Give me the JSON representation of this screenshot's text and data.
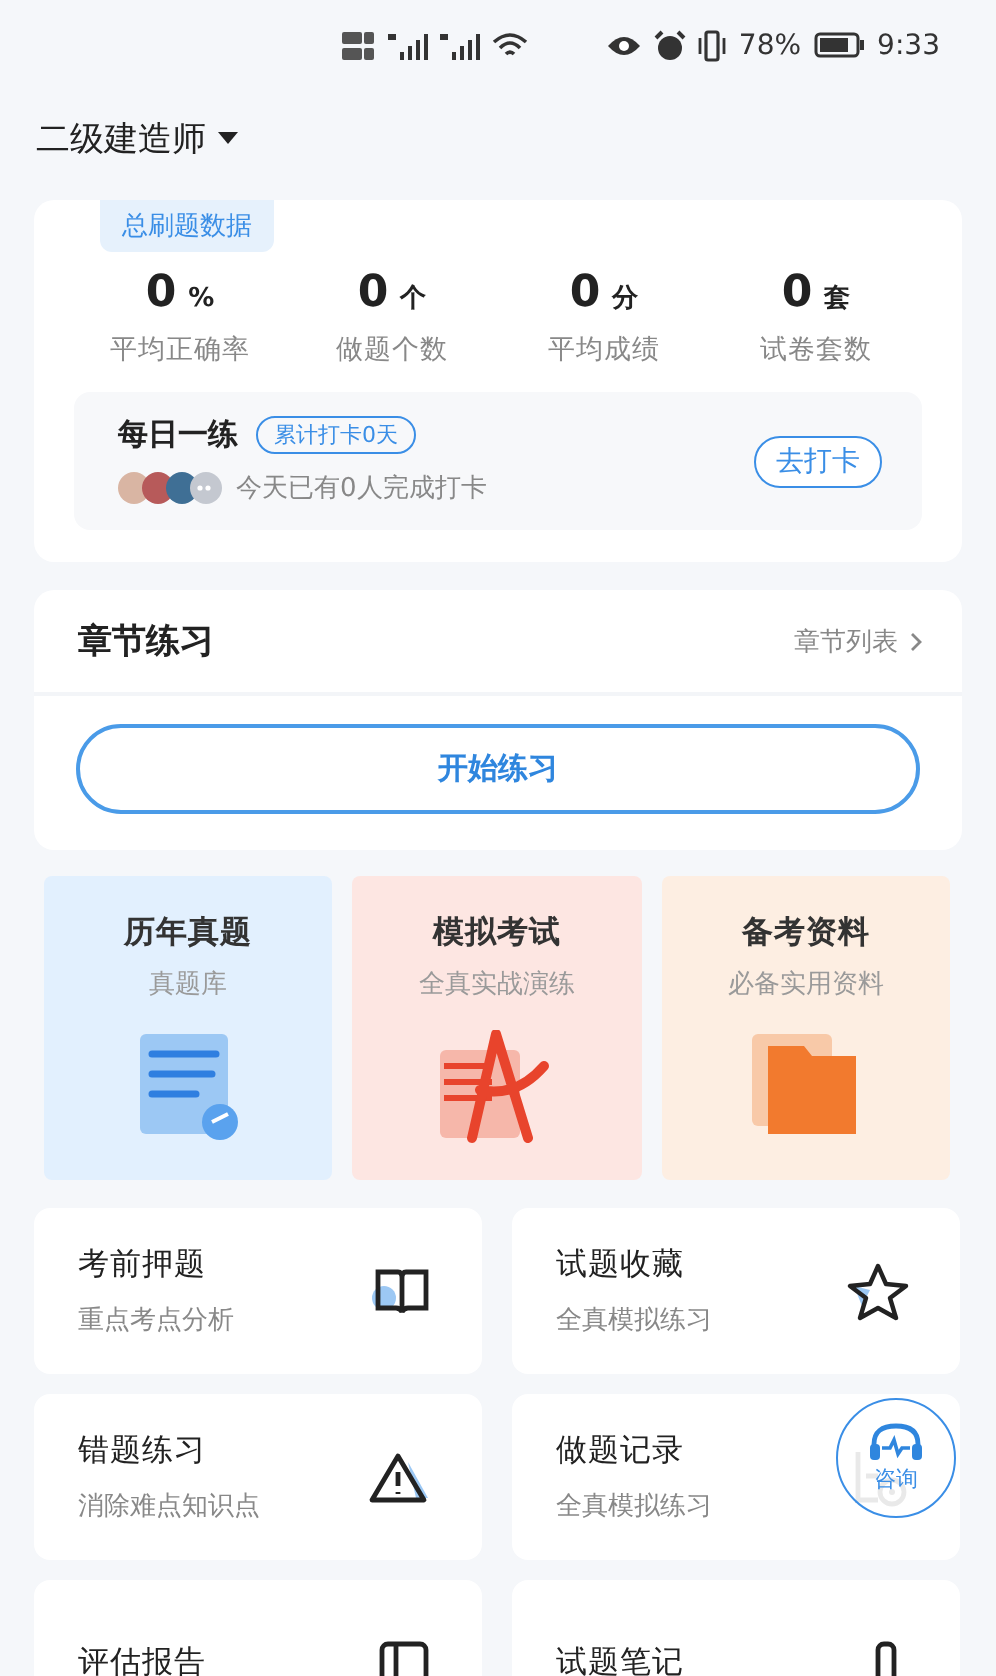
{
  "status_bar": {
    "battery": "78%",
    "time": "9:33"
  },
  "header": {
    "title": "二级建造师"
  },
  "stats_card": {
    "tab": "总刷题数据",
    "stats": [
      {
        "value": "0",
        "unit": "%",
        "label": "平均正确率"
      },
      {
        "value": "0",
        "unit": "个",
        "label": "做题个数"
      },
      {
        "value": "0",
        "unit": "分",
        "label": "平均成绩"
      },
      {
        "value": "0",
        "unit": "套",
        "label": "试卷套数"
      }
    ],
    "daily": {
      "title": "每日一练",
      "badge": "累计打卡0天",
      "note": "今天已有0人完成打卡",
      "button": "去打卡"
    }
  },
  "chapter": {
    "title": "章节练习",
    "link": "章节列表",
    "button": "开始练习"
  },
  "tiles": [
    {
      "kind": "papers",
      "title": "历年真题",
      "subtitle": "真题库",
      "color": "#e2f0fe"
    },
    {
      "kind": "compass",
      "title": "模拟考试",
      "subtitle": "全真实战演练",
      "color": "#fde6e2"
    },
    {
      "kind": "folder",
      "title": "备考资料",
      "subtitle": "必备实用资料",
      "color": "#fdeee2"
    }
  ],
  "features": [
    {
      "kind": "book",
      "title": "考前押题",
      "subtitle": "重点考点分析"
    },
    {
      "kind": "star",
      "title": "试题收藏",
      "subtitle": "全真模拟练习"
    },
    {
      "kind": "warning",
      "title": "错题练习",
      "subtitle": "消除难点知识点"
    },
    {
      "kind": "record",
      "title": "做题记录",
      "subtitle": "全真模拟练习"
    },
    {
      "kind": "report",
      "title": "评估报告"
    },
    {
      "kind": "note",
      "title": "试题笔记"
    }
  ],
  "consult": {
    "label": "咨询"
  }
}
